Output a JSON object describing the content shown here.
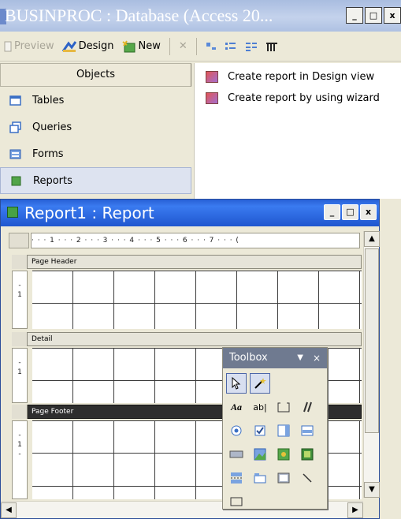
{
  "db_window": {
    "title": "BUSINPROC : Database (Access 20...",
    "buttons": {
      "minimize": "_",
      "maximize": "□",
      "close": "x"
    }
  },
  "db_toolbar": {
    "preview_label": "Preview",
    "design_label": "Design",
    "new_label": "New",
    "delete_symbol": "✕"
  },
  "objects_panel": {
    "header": "Objects",
    "items": [
      {
        "label": "Tables",
        "icon": "tables-icon"
      },
      {
        "label": "Queries",
        "icon": "queries-icon"
      },
      {
        "label": "Forms",
        "icon": "forms-icon"
      },
      {
        "label": "Reports",
        "icon": "reports-icon",
        "selected": true
      }
    ]
  },
  "reports_list": [
    "Create report in Design view",
    "Create report by using wizard"
  ],
  "report_window": {
    "title": "Report1 : Report",
    "buttons": {
      "minimize": "_",
      "maximize": "□",
      "close": "x"
    },
    "ruler": "· · · 1 · · · 2 · · · 3 · · · 4 · · · 5 · · · 6 · · · 7 · · · (",
    "sections": [
      {
        "label": "Page Header"
      },
      {
        "label": "Detail"
      },
      {
        "label": "Page Footer"
      }
    ],
    "vruler_mark": "1"
  },
  "toolbox": {
    "title": "Toolbox",
    "dropdown": "▼",
    "close": "×",
    "tools": [
      "select-objects-tool",
      "control-wizards-tool",
      "label-tool",
      "text-box-tool",
      "option-group-tool",
      "toggle-button-tool",
      "option-button-tool",
      "check-box-tool",
      "combo-box-tool",
      "list-box-tool",
      "command-button-tool",
      "image-tool",
      "unbound-object-frame-tool",
      "bound-object-frame-tool",
      "page-break-tool",
      "tab-control-tool",
      "subform-tool",
      "line-tool",
      "rectangle-tool"
    ],
    "label_glyph": "Aa",
    "textbox_glyph": "ab|"
  },
  "colors": {
    "title_blue": "#2860d5",
    "toolbox_title": "#6f7a90",
    "selected_item": "#dde3f0"
  }
}
